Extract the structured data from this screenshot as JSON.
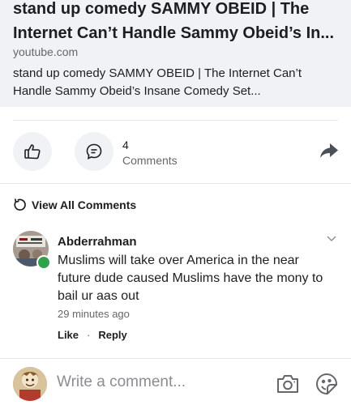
{
  "link_preview": {
    "title_line1": "stand up comedy SAMMY OBEID | The",
    "title_line2": "Internet Can’t Handle Sammy Obeid’s In...",
    "domain": "youtube.com",
    "description_line1": "stand up comedy SAMMY OBEID | The Internet Can’t",
    "description_line2": "Handle Sammy Obeid’s Insane Comedy Set..."
  },
  "actions": {
    "like_icon": "thumbs-up-icon",
    "comment_icon": "comment-bubble-icon",
    "comment_count": "4",
    "comment_count_label": "Comments",
    "share_icon": "share-arrow-icon"
  },
  "view_all": {
    "icon": "refresh-icon",
    "label": "View All Comments"
  },
  "comment": {
    "author": "Abderrahman",
    "text_lines": [
      "Muslims will take over America in the near",
      "future dude caused Muslims have the mony to",
      "bail ur aas out"
    ],
    "time": "29 minutes ago",
    "like_label": "Like",
    "separator": "·",
    "reply_label": "Reply",
    "online_color": "#31a24c"
  },
  "composer": {
    "placeholder": "Write a comment...",
    "camera_icon": "camera-icon",
    "sticker_icon": "sticker-icon"
  }
}
